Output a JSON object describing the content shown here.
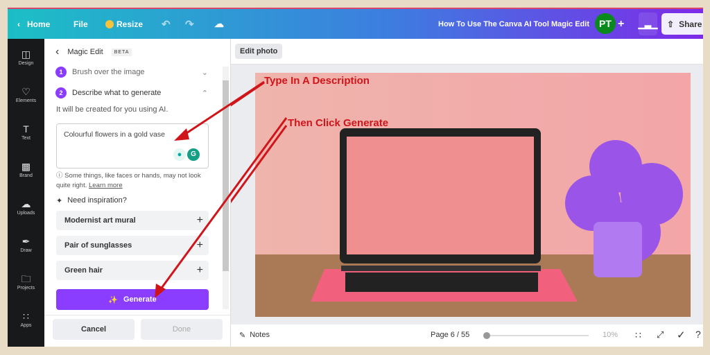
{
  "topbar": {
    "home": "Home",
    "file": "File",
    "resize": "Resize",
    "title": "How To Use The Canva AI Tool Magic Edit",
    "avatar": "PT",
    "share": "Share"
  },
  "sidebar": {
    "items": [
      {
        "label": "Design",
        "icon": "layout-icon"
      },
      {
        "label": "Elements",
        "icon": "shapes-icon"
      },
      {
        "label": "Text",
        "icon": "text-icon"
      },
      {
        "label": "Brand",
        "icon": "brand-icon"
      },
      {
        "label": "Uploads",
        "icon": "cloud-upload-icon"
      },
      {
        "label": "Draw",
        "icon": "pen-icon"
      },
      {
        "label": "Projects",
        "icon": "folder-icon"
      },
      {
        "label": "Apps",
        "icon": "grid-icon"
      }
    ]
  },
  "panel": {
    "title": "Magic Edit",
    "badge": "BETA",
    "step1": {
      "num": "1",
      "label": "Brush over the image"
    },
    "step2": {
      "num": "2",
      "label": "Describe what to generate"
    },
    "hint": "It will be created for you using AI.",
    "prompt_value": "Colourful flowers in a gold vase",
    "disclaimer": "Some things, like faces or hands, may not look quite right.",
    "learn_more": "Learn more",
    "inspiration": "Need inspiration?",
    "suggestions": [
      "Modernist art mural",
      "Pair of sunglasses",
      "Green hair"
    ],
    "generate": "Generate",
    "cancel": "Cancel",
    "done": "Done"
  },
  "canvas": {
    "edit_photo": "Edit photo"
  },
  "annotations": {
    "a1": "Type In A Description",
    "a2": "Then Click Generate",
    "color": "#d0151a"
  },
  "bottombar": {
    "notes": "Notes",
    "page": "Page 6 / 55",
    "zoom": "10%",
    "zoom_percent": 10
  },
  "colors": {
    "accent": "#8b3dff",
    "avatar": "#0a8a1e"
  }
}
